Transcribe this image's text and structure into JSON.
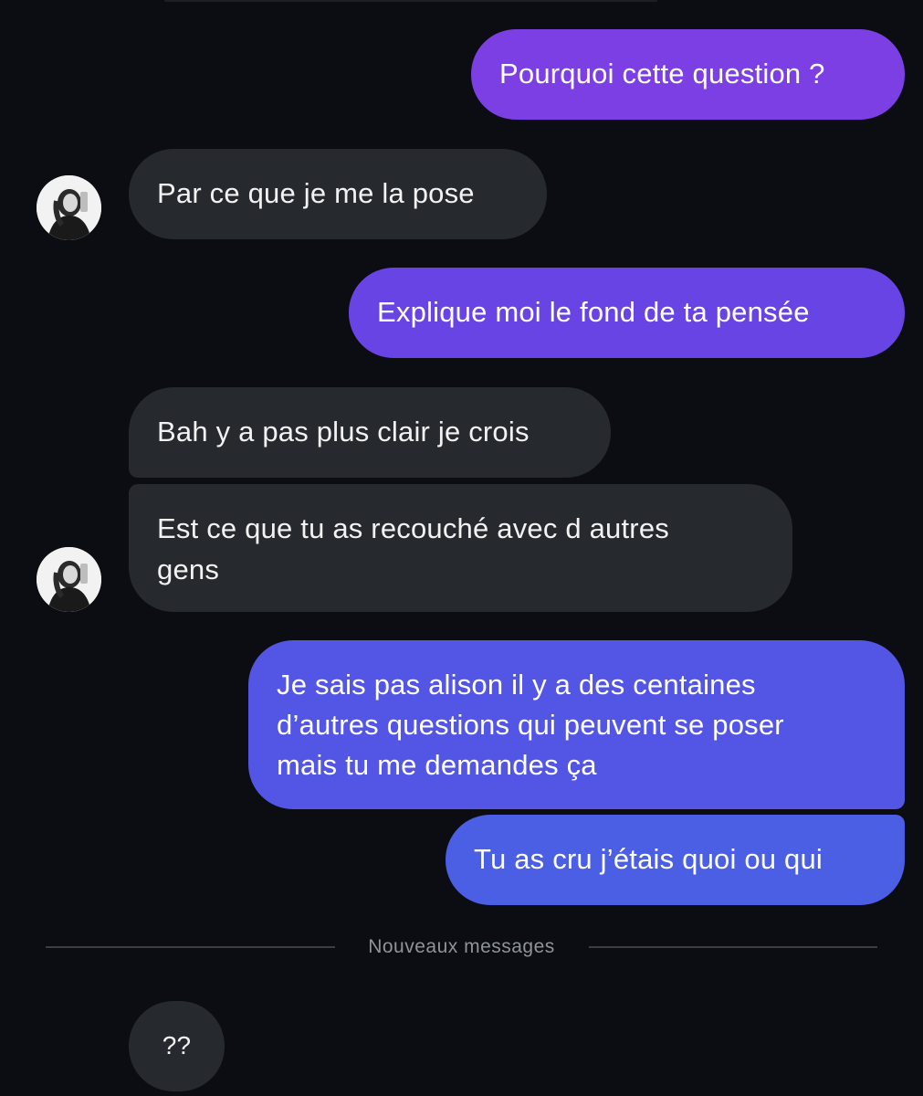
{
  "conversation": {
    "messages": [
      {
        "direction": "outgoing",
        "text": "Pourquoi cette question ?"
      },
      {
        "direction": "incoming",
        "text": "Par ce que je me la pose"
      },
      {
        "direction": "outgoing",
        "text": "Explique moi le fond de ta pensée"
      },
      {
        "direction": "incoming",
        "text": "Bah y a pas plus clair je crois"
      },
      {
        "direction": "incoming",
        "text": "Est ce que tu as recouché avec  d autres\ngens"
      },
      {
        "direction": "outgoing",
        "text": "Je sais pas alison il y a des centaines\nd’autres questions qui peuvent se poser\nmais tu me demandes ça"
      },
      {
        "direction": "outgoing",
        "text": "Tu as cru j’étais quoi ou qui"
      },
      {
        "direction": "incoming",
        "text": "??"
      }
    ],
    "new_messages_label": "Nouveaux messages"
  },
  "contact": {
    "avatar_icon": "contact-avatar-photo"
  },
  "colors": {
    "background": "#0b0d12",
    "incoming_bubble": "#26292e",
    "outgoing_gradient_top": "#7b3fe4",
    "outgoing_gradient_bottom": "#4a5fe3",
    "divider_text": "#8f939a"
  }
}
